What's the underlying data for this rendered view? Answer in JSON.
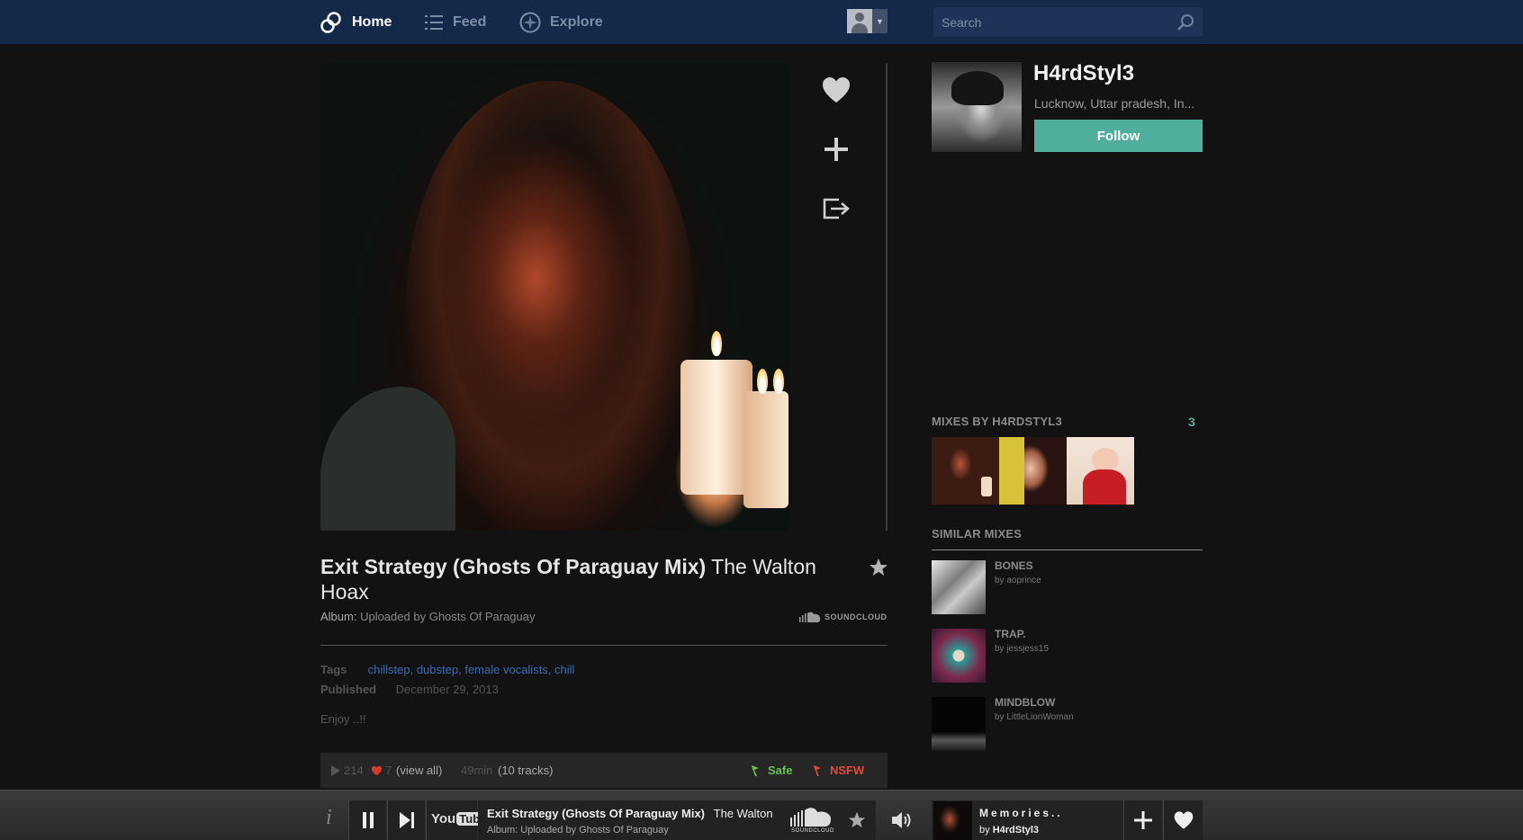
{
  "nav": {
    "home_label": "Home",
    "feed_label": "Feed",
    "explore_label": "Explore",
    "search_placeholder": "Search"
  },
  "mix": {
    "title": "Exit Strategy (Ghosts Of Paraguay Mix)",
    "artist": "The Walton Hoax",
    "album_label": "Album:",
    "album_value": "Uploaded by Ghosts Of Paraguay",
    "source_badge": "SOUNDCLOUD",
    "tags_label": "Tags",
    "tags": [
      "chillstep",
      "dubstep",
      "female vocalists",
      "chill"
    ],
    "published_label": "Published",
    "published_value": "December 29, 2013",
    "description": "Enjoy ..!!",
    "plays": "214",
    "likes": "7",
    "view_all": "(view all)",
    "duration": "49min",
    "tracks": "(10 tracks)",
    "safe_label": "Safe",
    "nsfw_label": "NSFW"
  },
  "dj": {
    "name": "H4rdStyl3",
    "location": "Lucknow, Uttar pradesh, In...",
    "follow_label": "Follow"
  },
  "mixes_by": {
    "heading": "MIXES BY H4RDSTYL3",
    "count": "3"
  },
  "similar": {
    "heading": "SIMILAR MIXES",
    "items": [
      {
        "title": "BONES",
        "by": "by aoprince"
      },
      {
        "title": "TRAP.",
        "by": "by jessjess15"
      },
      {
        "title": "MINDBLOW",
        "by": "by LittleLionWoman"
      }
    ]
  },
  "player": {
    "info_glyph": "i",
    "youtube_you": "You",
    "youtube_tube": "Tube",
    "track_title": "Exit Strategy (Ghosts Of Paraguay Mix)",
    "track_artist": "The Walton",
    "album": "Album: Uploaded by Ghosts Of Paraguay",
    "source_badge": "SOUNDCLOUD",
    "next_title": "Memories..",
    "next_by_prefix": "by",
    "next_by_user": "H4rdStyl3"
  },
  "colors": {
    "topbar": "#14284a",
    "accent_teal": "#4faf9c",
    "tag_link": "#3d6bb3",
    "safe": "#6cc24a",
    "nsfw": "#e24a3b",
    "like_heart": "#d9372b"
  }
}
